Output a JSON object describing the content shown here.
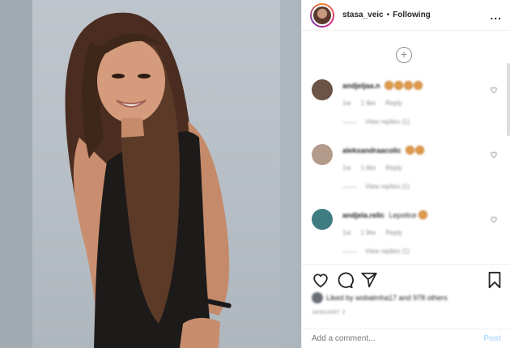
{
  "header": {
    "username": "stasa_veic",
    "separator": "•",
    "follow_status": "Following",
    "more_label": "..."
  },
  "comments": {
    "load_more_label": "+",
    "items": [
      {
        "username": "andjeljaa.n",
        "text": "",
        "emoji_count": 4,
        "time": "1w",
        "likes": "1 like",
        "reply": "Reply",
        "view_replies": "View replies (1)",
        "avatar_color": "#6b5445"
      },
      {
        "username": "aleksandraacolic",
        "text": "",
        "emoji_count": 2,
        "time": "1w",
        "likes": "1 like",
        "reply": "Reply",
        "view_replies": "View replies (1)",
        "avatar_color": "#b49a8b"
      },
      {
        "username": "andjela.relic",
        "text": "Lepotice",
        "emoji_count": 1,
        "time": "1w",
        "likes": "1 like",
        "reply": "Reply",
        "view_replies": "View replies (1)",
        "avatar_color": "#3f7d82"
      }
    ]
  },
  "actions": {
    "likes_text": "Liked by wobalmha17 and 978 others",
    "date": "JANUARY 2"
  },
  "add_comment": {
    "placeholder": "Add a comment...",
    "post_label": "Post"
  },
  "colors": {
    "accent": "#0095f6",
    "post_disabled": "#b3dbff",
    "muted": "#8e8e8e"
  }
}
